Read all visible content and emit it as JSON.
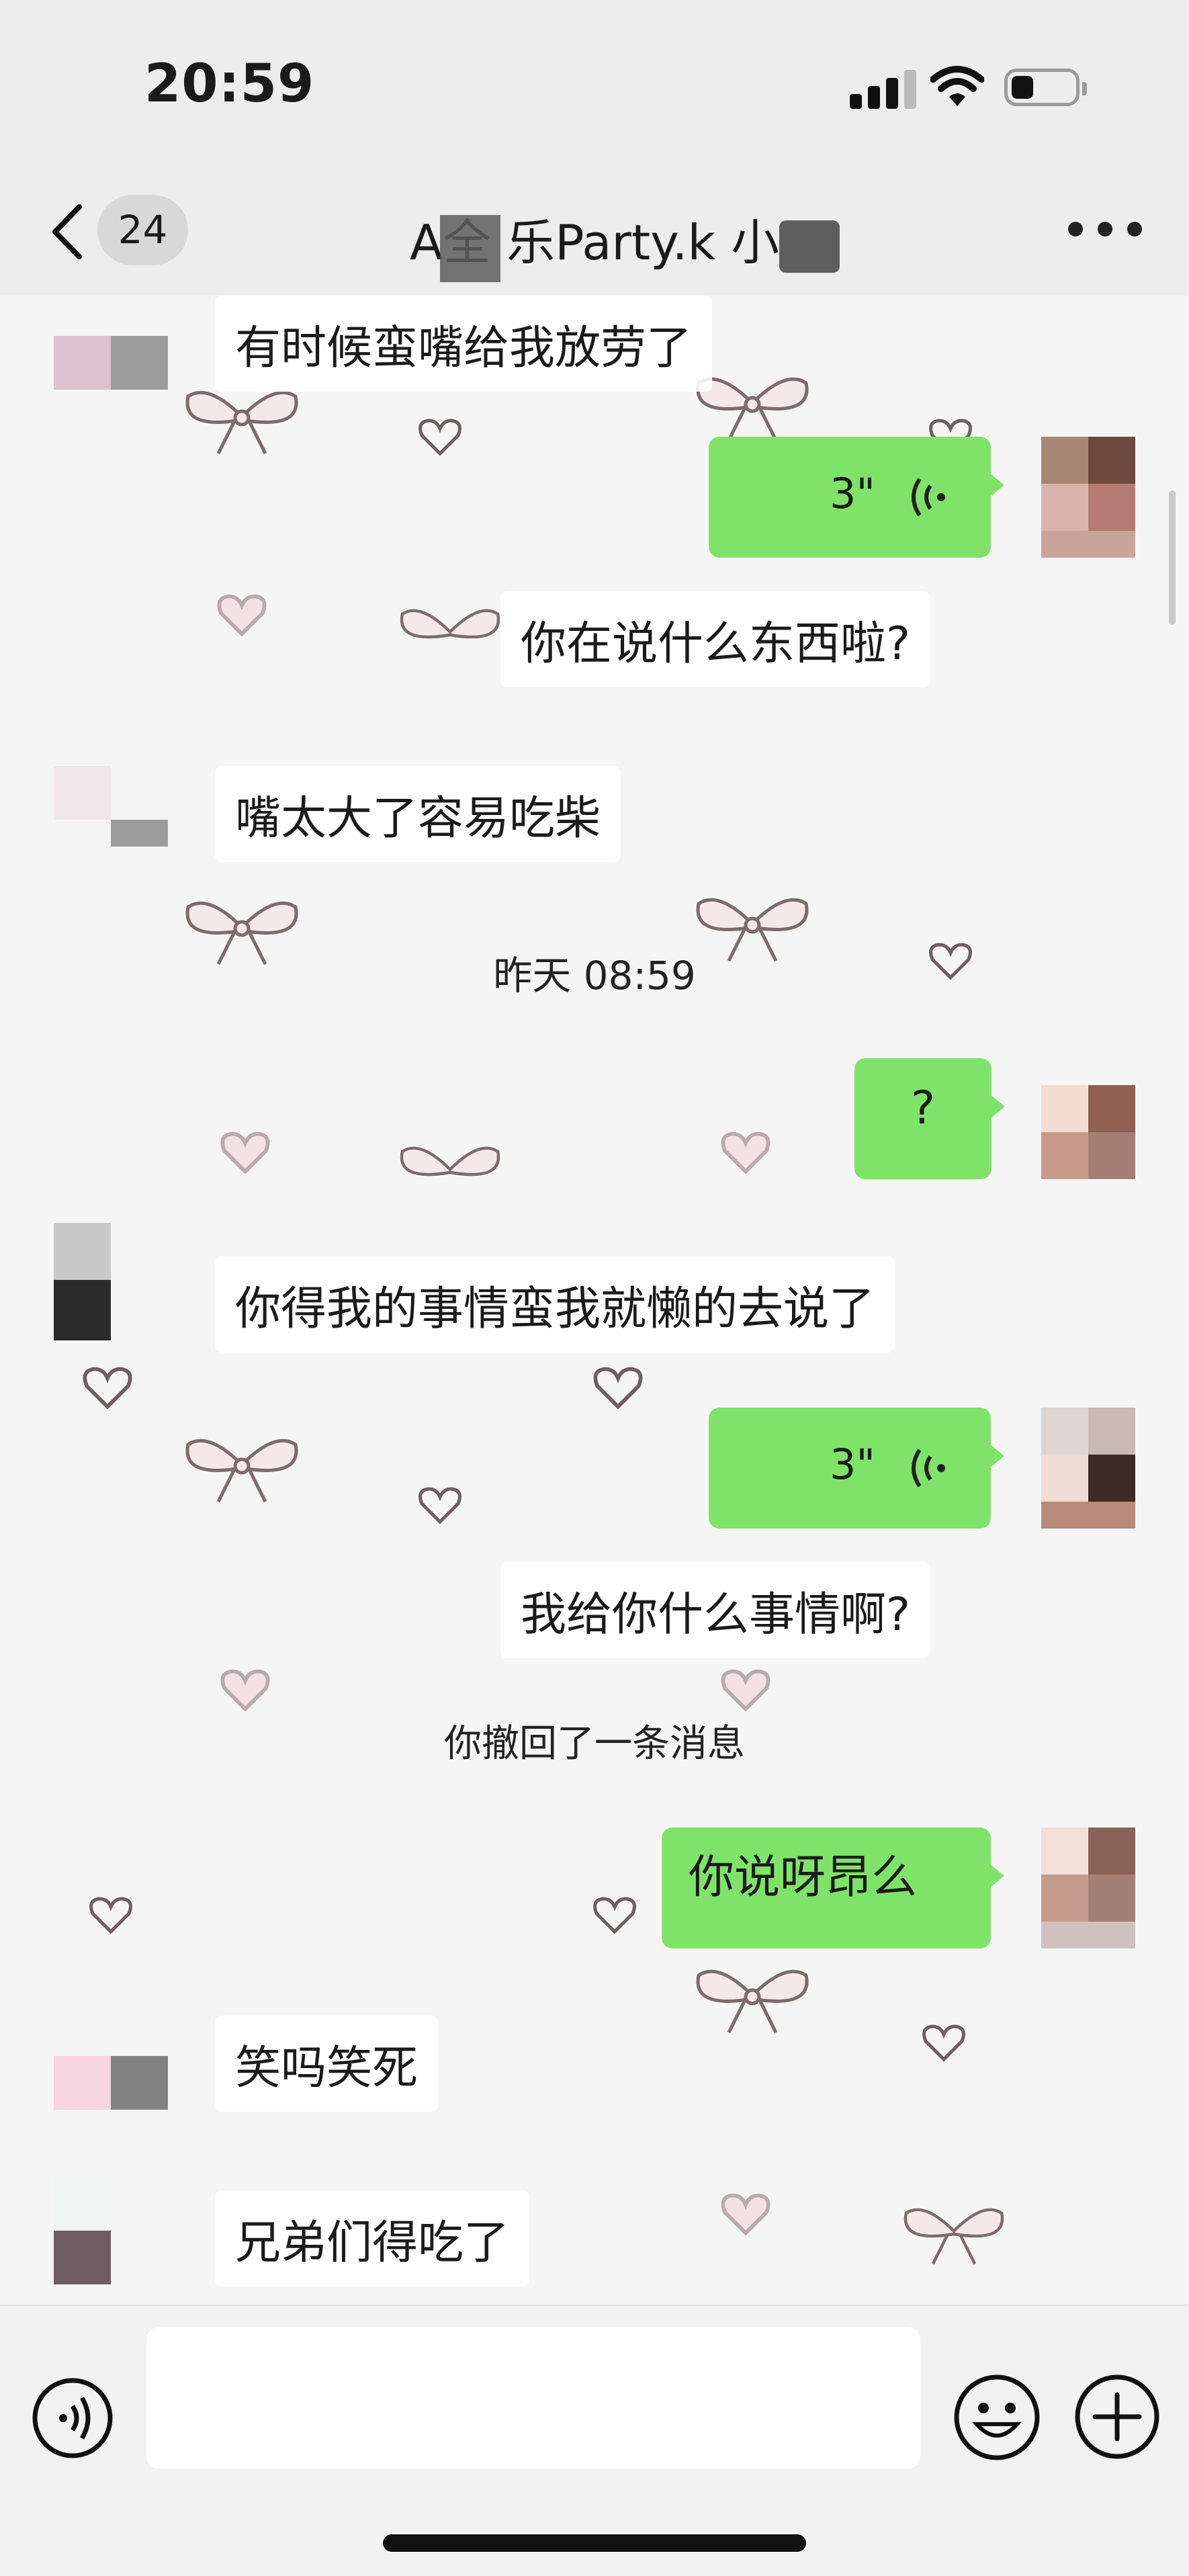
{
  "status_bar": {
    "time": "20:59"
  },
  "nav": {
    "unread_count": "24",
    "title": "A全  乐Party.k 小  "
  },
  "messages": [
    {
      "side": "left",
      "text": "有时候蛮嘴给我放劳了"
    },
    {
      "side": "right",
      "type": "voice",
      "duration": "3\"",
      "transcript": "你在说什么东西啦?"
    },
    {
      "side": "left",
      "text": "嘴太大了容易吃柴"
    },
    {
      "type": "timestamp",
      "text": "昨天 08:59"
    },
    {
      "side": "right",
      "text": "?"
    },
    {
      "side": "left",
      "text": "你得我的事情蛮我就懒的去说了"
    },
    {
      "side": "right",
      "type": "voice",
      "duration": "3\"",
      "transcript": "我给你什么事情啊?"
    },
    {
      "type": "system",
      "text": "你撤回了一条消息"
    },
    {
      "side": "right",
      "text": "你说呀昂么"
    },
    {
      "side": "left",
      "text": "笑吗笑死"
    },
    {
      "side": "left",
      "text": "兄弟们得吃了"
    }
  ],
  "icons": {
    "back": "chevron-left-icon",
    "more": "ellipsis-icon",
    "voice_toggle": "voice-icon",
    "emoji": "smiley-icon",
    "plus": "plus-icon"
  },
  "colors": {
    "sent_bubble": "#7fe36a",
    "received_bubble": "#ffffff",
    "background": "#f6f5f5"
  }
}
